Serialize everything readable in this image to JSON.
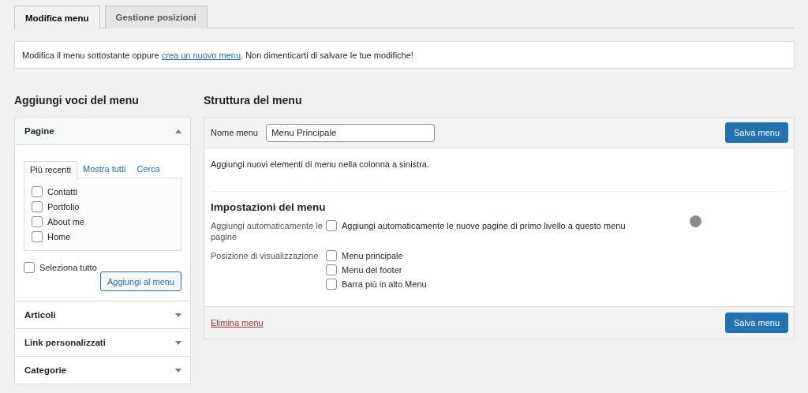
{
  "tabs": [
    {
      "label": "Modifica menu",
      "selected": true
    },
    {
      "label": "Gestione posizioni",
      "selected": false
    }
  ],
  "notice": {
    "text_before": "Modifica il menu sottostante oppure ",
    "link": "crea un nuovo menu",
    "text_after": ". Non dimenticarti di salvare le tue modifiche!"
  },
  "add_items": {
    "title": "Aggiungi voci del menu",
    "sections": [
      {
        "title": "Pagine",
        "expanded": true,
        "tabs": [
          {
            "label": "Più recenti",
            "selected": true
          },
          {
            "label": "Mostra tutti",
            "selected": false
          },
          {
            "label": "Cerca",
            "selected": false
          }
        ],
        "items": [
          {
            "label": "Contatti",
            "checked": false
          },
          {
            "label": "Portfolio",
            "checked": false
          },
          {
            "label": "About me",
            "checked": false
          },
          {
            "label": "Home",
            "checked": false
          }
        ],
        "select_all": {
          "label": "Seleziona tutto",
          "checked": false
        },
        "add_button": "Aggiungi al menu"
      },
      {
        "title": "Articoli",
        "expanded": false
      },
      {
        "title": "Link personalizzati",
        "expanded": false
      },
      {
        "title": "Categorie",
        "expanded": false
      }
    ]
  },
  "structure": {
    "title": "Struttura del menu",
    "name_label": "Nome menu",
    "name_value": "Menu Principale",
    "save_button": "Salva menu",
    "hint": "Aggiungi nuovi elementi di menu nella colonna a sinistra.",
    "settings_title": "Impostazioni del menu",
    "auto_add": {
      "label": "Aggiungi automaticamente le pagine",
      "options": [
        {
          "label": "Aggiungi automaticamente le nuove pagine di primo livello a questo menu",
          "checked": false
        }
      ]
    },
    "locations": {
      "label": "Posizione di visualizzazione",
      "options": [
        {
          "label": "Menu principale",
          "checked": false
        },
        {
          "label": "Menu del footer",
          "checked": false
        },
        {
          "label": "Barra più in alto Menu",
          "checked": false
        }
      ]
    },
    "delete_link": "Elimina menu",
    "footer_save_button": "Salva menu"
  }
}
